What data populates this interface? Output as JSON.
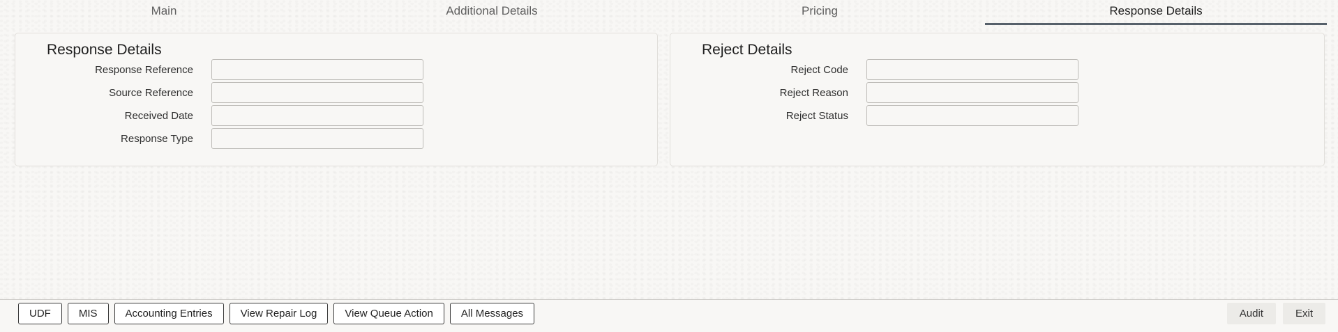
{
  "tabs": [
    {
      "label": "Main",
      "active": false
    },
    {
      "label": "Additional Details",
      "active": false
    },
    {
      "label": "Pricing",
      "active": false
    },
    {
      "label": "Response Details",
      "active": true
    }
  ],
  "response_panel": {
    "title": "Response Details",
    "fields": [
      {
        "label": "Response Reference",
        "value": ""
      },
      {
        "label": "Source Reference",
        "value": ""
      },
      {
        "label": "Received Date",
        "value": ""
      },
      {
        "label": "Response Type",
        "value": ""
      }
    ]
  },
  "reject_panel": {
    "title": "Reject Details",
    "fields": [
      {
        "label": "Reject Code",
        "value": ""
      },
      {
        "label": "Reject Reason",
        "value": ""
      },
      {
        "label": "Reject Status",
        "value": ""
      }
    ]
  },
  "footer": {
    "left_buttons": [
      "UDF",
      "MIS",
      "Accounting Entries",
      "View Repair Log",
      "View Queue Action",
      "All Messages"
    ],
    "right_buttons": [
      "Audit",
      "Exit"
    ]
  }
}
